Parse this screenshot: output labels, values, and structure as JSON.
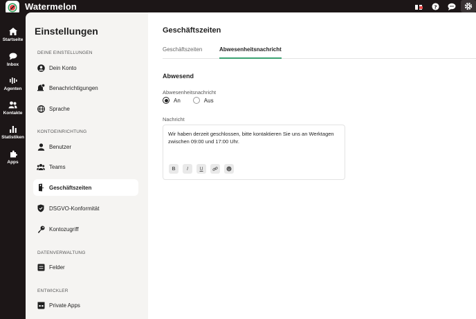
{
  "app": {
    "brand": "Watermelon"
  },
  "rail": {
    "items": [
      {
        "label": "Startseite",
        "icon": "home-icon"
      },
      {
        "label": "Inbox",
        "icon": "inbox-icon"
      },
      {
        "label": "Agenten",
        "icon": "agents-icon"
      },
      {
        "label": "Kontakte",
        "icon": "contacts-icon"
      },
      {
        "label": "Statistiken",
        "icon": "statistics-icon"
      },
      {
        "label": "Apps",
        "icon": "apps-icon"
      }
    ]
  },
  "settings": {
    "title": "Einstellungen",
    "sections": [
      {
        "label": "DEINE EINSTELLUNGEN",
        "items": [
          "Dein Konto",
          "Benachrichtigungen",
          "Sprache"
        ]
      },
      {
        "label": "KONTOEINRICHTUNG",
        "items": [
          "Benutzer",
          "Teams",
          "Geschäftszeiten",
          "DSGVO-Konformität",
          "Kontozugriff"
        ]
      },
      {
        "label": "DATENVERWALTUNG",
        "items": [
          "Felder"
        ]
      },
      {
        "label": "ENTWICKLER",
        "items": [
          "Private Apps"
        ]
      }
    ],
    "selected": "Geschäftszeiten"
  },
  "main": {
    "title": "Geschäftszeiten",
    "tabs": [
      {
        "label": "Geschäftszeiten",
        "active": false
      },
      {
        "label": "Abwesenheitsnachricht",
        "active": true
      }
    ],
    "section_title": "Abwesend",
    "away_label": "Abwesenheitsnachricht",
    "radio_on": "An",
    "radio_off": "Aus",
    "radio_selected": "An",
    "message_label": "Nachricht",
    "message_text": "Wir haben derzeit geschlossen, bitte kontaktieren Sie uns an Werktagen zwischen 09:00 und 17:00 Uhr.",
    "toolbar": {
      "bold": "B",
      "italic": "I",
      "underline": "U"
    }
  },
  "colors": {
    "sidebar": "#1c1617",
    "accent": "#3aa271",
    "panel": "#f5f4f2"
  }
}
